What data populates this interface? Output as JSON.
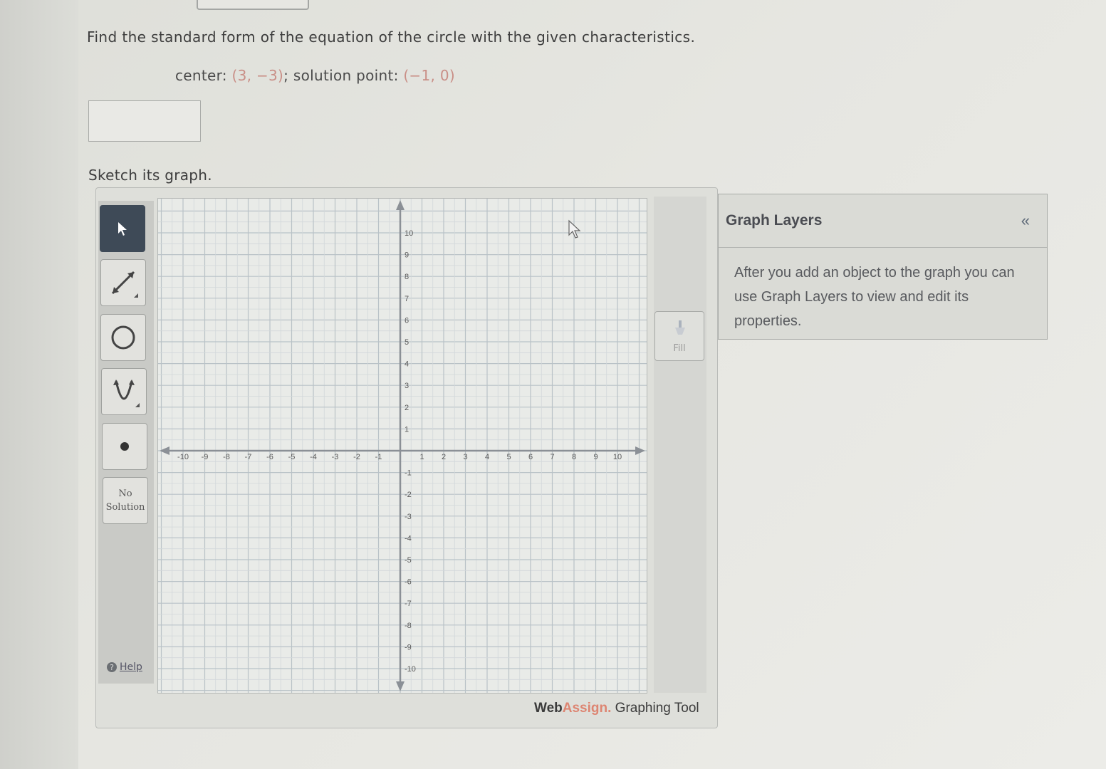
{
  "problem": {
    "instruction": "Find the standard form of the equation of the circle with the given characteristics.",
    "center_label": "center:",
    "center_value": "(3, −3)",
    "solution_label": "; solution point:",
    "solution_value": "(−1, 0)",
    "answer_value": "",
    "sketch_prompt": "Sketch its graph."
  },
  "toolbar": {
    "tools": [
      {
        "name": "pointer-tool",
        "icon": "arrow-cursor-icon",
        "active": true
      },
      {
        "name": "line-tool",
        "icon": "line-segment-icon"
      },
      {
        "name": "circle-tool",
        "icon": "circle-icon"
      },
      {
        "name": "parabola-tool",
        "icon": "parabola-icon"
      },
      {
        "name": "point-tool",
        "icon": "point-icon"
      }
    ],
    "no_solution_line1": "No",
    "no_solution_line2": "Solution",
    "help_label": "Help"
  },
  "graph": {
    "x_range": [
      -10,
      10
    ],
    "y_range": [
      -10,
      10
    ],
    "x_ticks": [
      "-10",
      "-9",
      "-8",
      "-7",
      "-6",
      "-5",
      "-4",
      "-3",
      "-2",
      "-1",
      "1",
      "2",
      "3",
      "4",
      "5",
      "6",
      "7",
      "8",
      "9",
      "10"
    ],
    "y_ticks": [
      "10",
      "9",
      "8",
      "7",
      "6",
      "5",
      "4",
      "3",
      "2",
      "1",
      "-1",
      "-2",
      "-3",
      "-4",
      "-5",
      "-6",
      "-7",
      "-8",
      "-9",
      "-10"
    ],
    "grid": true,
    "minor_divisions_per_unit": 2
  },
  "fill_button": {
    "label": "Fill"
  },
  "branding": {
    "web": "Web",
    "assign": "Assign.",
    "tool": " Graphing Tool"
  },
  "graph_layers": {
    "title": "Graph Layers",
    "collapse_icon": "«",
    "description": "After you add an object to the graph you can use Graph Layers to view and edit its properties."
  }
}
